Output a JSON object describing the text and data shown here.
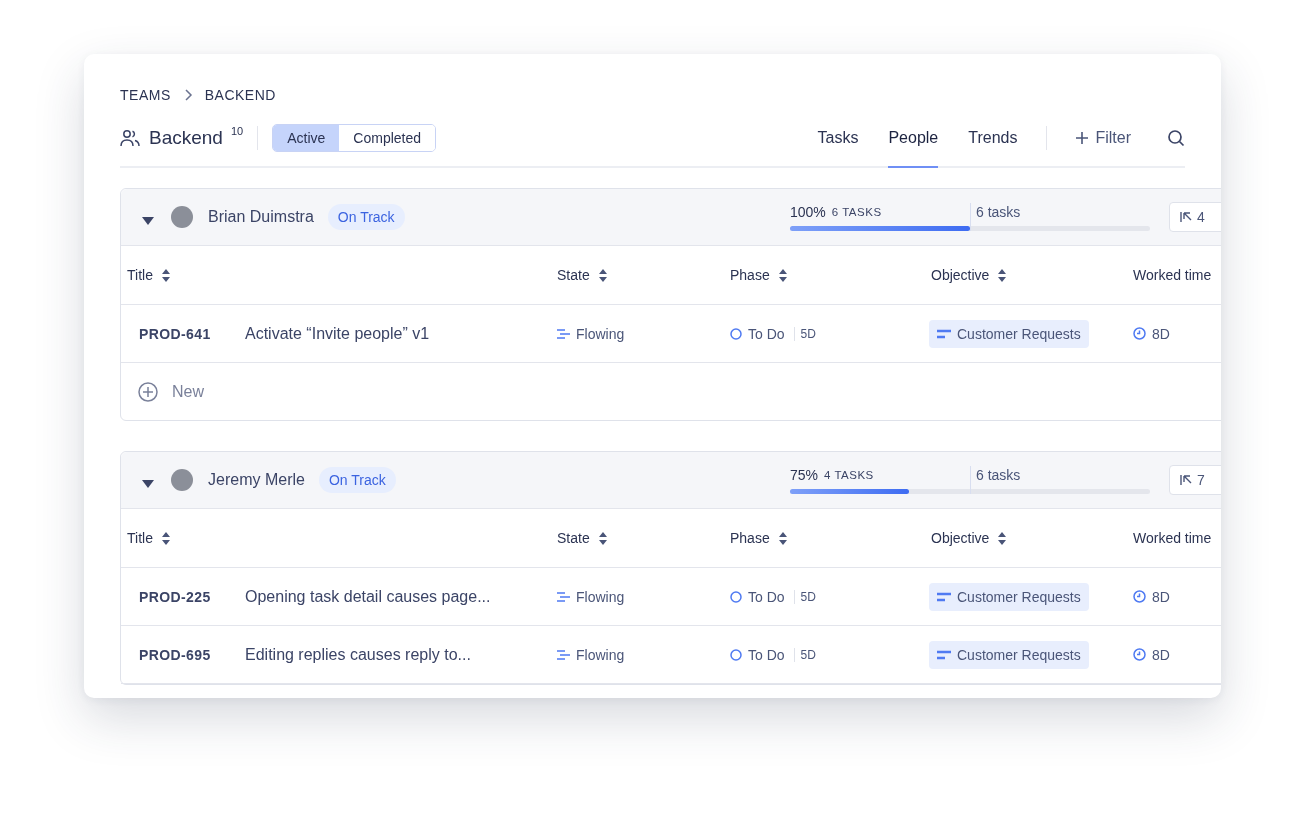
{
  "breadcrumb": [
    "TEAMS",
    "BACKEND"
  ],
  "team": {
    "name": "Backend",
    "count": "10"
  },
  "segments": [
    {
      "label": "Active",
      "selected": true
    },
    {
      "label": "Completed",
      "selected": false
    }
  ],
  "tabs": [
    {
      "label": "Tasks",
      "selected": false
    },
    {
      "label": "People",
      "selected": true
    },
    {
      "label": "Trends",
      "selected": false
    }
  ],
  "filter": {
    "label": "Filter"
  },
  "groups": [
    {
      "name": "Brian Duimstra",
      "expanded": true,
      "status": "On Track",
      "percent": "100%",
      "done": "6 TASKS",
      "total": "6 tasks",
      "level": 0.5,
      "count": "4",
      "columns": [
        "Title",
        "State",
        "Phase",
        "Objective",
        "Worked time"
      ],
      "rows": [
        {
          "key": "PROD-641",
          "title": "Activate “Invite people” v1",
          "state": "Flowing",
          "phase": "To Do",
          "phase_time": "5D",
          "objective": "Customer Requests",
          "worked": "8D"
        }
      ],
      "new_label": "New"
    },
    {
      "name": "Jeremy Merle",
      "expanded": true,
      "status": "On Track",
      "percent": "75%",
      "done": "4 TASKS",
      "total": "6 tasks",
      "level": 0.33,
      "count": "7",
      "columns": [
        "Title",
        "State",
        "Phase",
        "Objective",
        "Worked time"
      ],
      "rows": [
        {
          "key": "PROD-225",
          "title": "Opening task detail causes page...",
          "state": "Flowing",
          "phase": "To Do",
          "phase_time": "5D",
          "objective": "Customer Requests",
          "worked": "8D"
        },
        {
          "key": "PROD-695",
          "title": "Editing replies causes reply to...",
          "state": "Flowing",
          "phase": "To Do",
          "phase_time": "5D",
          "objective": "Customer Requests",
          "worked": "8D"
        }
      ]
    }
  ]
}
